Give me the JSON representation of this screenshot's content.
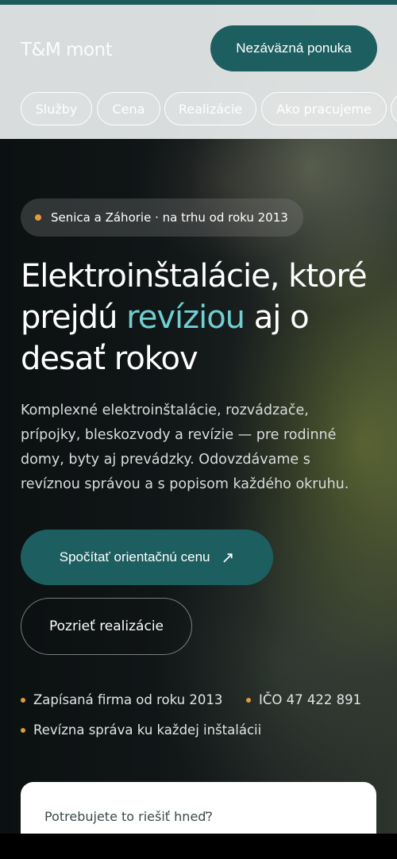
{
  "header": {
    "logo": "T&M mont",
    "cta_label": "Nezáväzná ponuka"
  },
  "nav": {
    "items": [
      {
        "label": "Služby"
      },
      {
        "label": "Cena"
      },
      {
        "label": "Realizácie"
      },
      {
        "label": "Ako pracujeme"
      },
      {
        "label": ""
      }
    ]
  },
  "hero": {
    "badge": "Senica a Záhorie · na trhu od roku 2013",
    "headline_part1": "Elektroinštalácie, ktoré prejdú ",
    "headline_accent": "revíziou",
    "headline_part2": " aj o desať rokov",
    "lead": "Komplexné elektroinštalácie, rozvádzače, prípojky, bleskozvody a revízie — pre rodinné domy, byty aj prevádzky. Odovzdávame s revíznou správou a s popisom každého okruhu.",
    "primary_button": "Spočítať orientačnú cenu",
    "primary_button_icon": "↗",
    "secondary_button": "Pozrieť realizácie",
    "facts": [
      "Zapísaná firma od roku 2013",
      "IČO 47 422 891",
      "Revízna správa ku každej inštalácii"
    ]
  },
  "card": {
    "text": "Potrebujete to riešiť hneď?"
  },
  "colors": {
    "accent_teal": "#1d5f61",
    "headline_accent": "#6fcfd1",
    "bullet_orange": "#e39a3b"
  }
}
